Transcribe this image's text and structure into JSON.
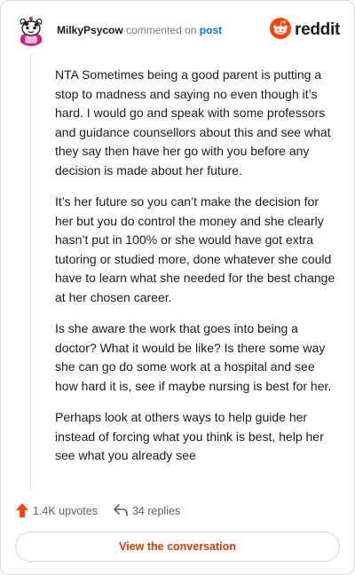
{
  "header": {
    "username": "MilkyPsycow",
    "action_text": "commented on",
    "target_text": "post",
    "brand_name": "reddit"
  },
  "comment": {
    "paragraphs": [
      "NTA Sometimes being a good parent is putting a stop to madness and saying no even though it’s hard. I would go and speak with some professors and guidance counsellors about this and see what they say then have her go with you before any decision is made about her future.",
      "It’s her future so you can’t make the decision for her but you do control the money and she clearly hasn’t put in 100% or she would have got extra tutoring or studied more, done whatever she could have to learn what she needed for the best change at her chosen career.",
      "Is she aware the work that goes into being a doctor? What it would be like? Is there some way she can go do some work at a hospital and see how hard it is, see if maybe nursing is best for her.",
      "Perhaps look at others ways to help guide her instead of forcing what you think is best, help her see what you already see"
    ]
  },
  "stats": {
    "upvotes": "1.4K upvotes",
    "replies": "34 replies"
  },
  "cta": {
    "label": "View the conversation"
  },
  "colors": {
    "brand_orange": "#ff4500",
    "link_blue": "#0079d3",
    "cta_text": "#d93a00",
    "upvote_arrow": "#ff4500"
  },
  "icons": {
    "avatar": "snoo-avatar-icon",
    "brand": "reddit-logo-icon",
    "upvote": "upvote-arrow-icon",
    "reply": "reply-arrow-icon"
  }
}
